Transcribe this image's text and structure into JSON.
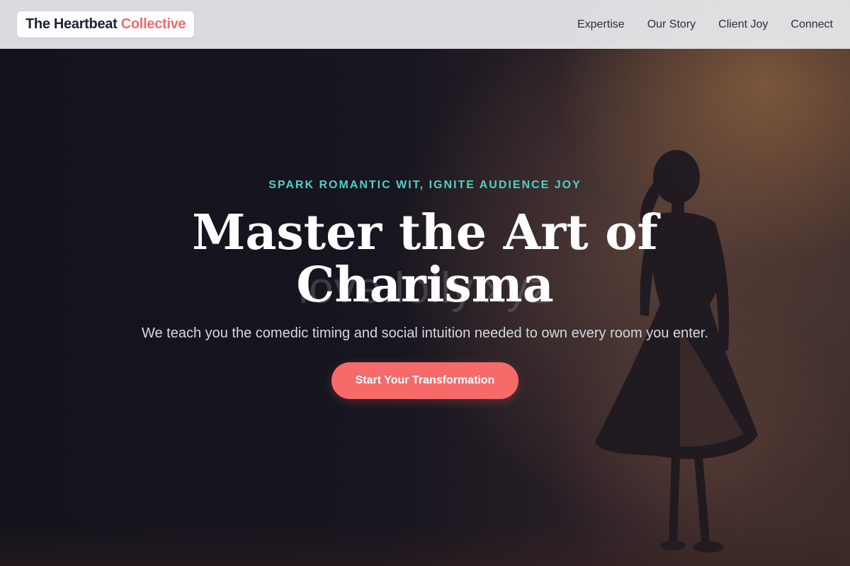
{
  "nav": {
    "brand_main": "The Heartbeat",
    "brand_accent": "Collective",
    "links": [
      {
        "label": "Expertise"
      },
      {
        "label": "Our Story"
      },
      {
        "label": "Client Joy"
      },
      {
        "label": "Connect"
      }
    ]
  },
  "hero": {
    "eyebrow": "SPARK ROMANTIC WIT, IGNITE AUDIENCE JOY",
    "title_line1": "Master the Art of",
    "title_line2": "Charisma",
    "watermark": "love.lolly.xyz",
    "subtitle": "We teach you the comedic timing and social intuition needed to own every room you enter.",
    "cta_label": "Start Your Transformation"
  },
  "colors": {
    "accent_coral": "#f66a6a",
    "accent_teal": "#4fd1c5",
    "background_dark": "#16141d",
    "nav_background": "#ececf0"
  }
}
